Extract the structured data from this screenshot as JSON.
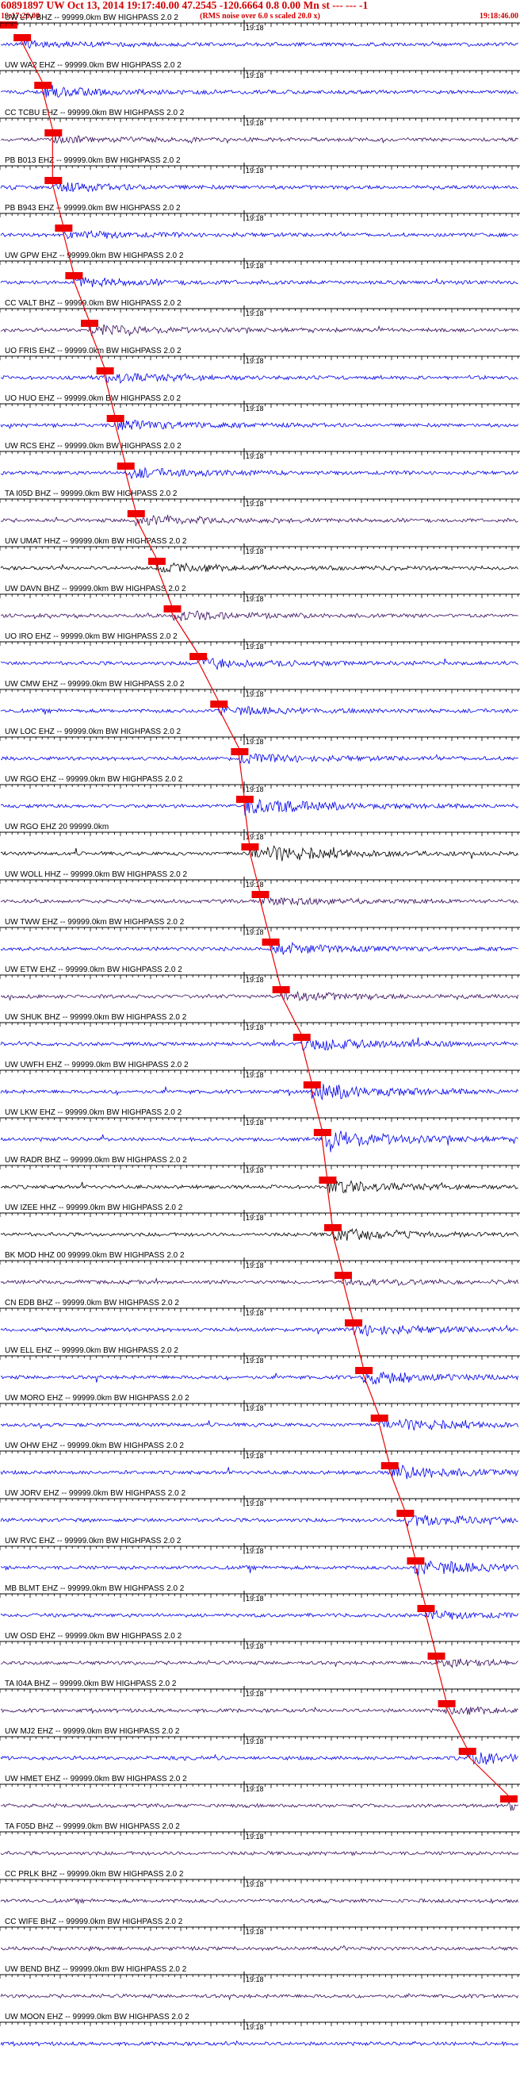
{
  "header": {
    "title": "60891897 UW Oct 13, 2014 19:17:40.00    47.2545 -120.6664  0.8 0.00 Mn st --- --- -1",
    "subtitle": "(RMS noise over 6.0 s scaled 20.0 x)",
    "start_time": "19:17:20.00",
    "end_time": "19:18:46.00"
  },
  "chart_data": {
    "type": "line",
    "time_axis": {
      "start": "19:17:20.00",
      "end": "19:18:46.00",
      "minute_mark": "19:18"
    },
    "trace_colors": {
      "blue": "#0000ee",
      "black": "#000000",
      "purple": "#3a1060",
      "pick": "#ee0000"
    },
    "traces": [
      {
        "label": "UW LTY BHZ -- 99999.0km BW  HIGHPASS  2.0  2",
        "color": "blue",
        "amp": 0.3,
        "pick": 0.04
      },
      {
        "label": "UW WA2 EHZ -- 99999.0km BW  HIGHPASS  2.0  2",
        "color": "blue",
        "amp": 0.55,
        "pick": 0.08
      },
      {
        "label": "CC TCBU EHZ -- 99999.0km BW  HIGHPASS  2.0  2",
        "color": "purple",
        "amp": 0.35,
        "pick": 0.1
      },
      {
        "label": "PB B013 EHZ -- 99999.0km BW  HIGHPASS  2.0  2",
        "color": "blue",
        "amp": 0.45,
        "pick": 0.1
      },
      {
        "label": "PB B943 EHZ -- 99999.0km BW  HIGHPASS  2.0  2",
        "color": "blue",
        "amp": 0.4,
        "pick": 0.12
      },
      {
        "label": "UW GPW EHZ -- 99999.0km BW  HIGHPASS  2.0  2",
        "color": "blue",
        "amp": 0.45,
        "pick": 0.14
      },
      {
        "label": "CC VALT BHZ -- 99999.0km BW  HIGHPASS  2.0  2",
        "color": "purple",
        "amp": 0.5,
        "pick": 0.17
      },
      {
        "label": "UO FRIS EHZ -- 99999.0km BW  HIGHPASS  2.0  2",
        "color": "blue",
        "amp": 0.5,
        "pick": 0.2
      },
      {
        "label": "UO HUO EHZ -- 99999.0km BW  HIGHPASS  2.0  2",
        "color": "blue",
        "amp": 0.55,
        "pick": 0.22
      },
      {
        "label": "UW RCS EHZ -- 99999.0km BW  HIGHPASS  2.0  2",
        "color": "blue",
        "amp": 0.5,
        "pick": 0.24
      },
      {
        "label": "TA I05D BHZ -- 99999.0km BW  HIGHPASS  2.0  2",
        "color": "purple",
        "amp": 0.6,
        "pick": 0.26
      },
      {
        "label": "UW UMAT HHZ -- 99999.0km BW  HIGHPASS  2.0  2",
        "color": "black",
        "amp": 0.5,
        "pick": 0.3
      },
      {
        "label": "UW DAVN BHZ -- 99999.0km BW  HIGHPASS  2.0  2",
        "color": "purple",
        "amp": 0.45,
        "pick": 0.33
      },
      {
        "label": "UO IRO EHZ -- 99999.0km BW  HIGHPASS  2.0  2",
        "color": "blue",
        "amp": 0.6,
        "pick": 0.38
      },
      {
        "label": "UW CMW EHZ -- 99999.0km BW  HIGHPASS  2.0  2",
        "color": "blue",
        "amp": 0.5,
        "pick": 0.42
      },
      {
        "label": "UW LOC EHZ -- 99999.0km BW  HIGHPASS  2.0  2",
        "color": "blue",
        "amp": 0.5,
        "pick": 0.46
      },
      {
        "label": "UW RGO EHZ -- 99999.0km BW  HIGHPASS  2.0  2",
        "color": "blue",
        "amp": 0.9,
        "pick": 0.47
      },
      {
        "label": "UW RGO EHZ 20 99999.0km",
        "color": "black",
        "amp": 1.0,
        "pick": 0.48
      },
      {
        "label": "UW WOLL HHZ -- 99999.0km BW  HIGHPASS  2.0  2",
        "color": "purple",
        "amp": 0.4,
        "pick": 0.5
      },
      {
        "label": "UW TWW EHZ -- 99999.0km BW  HIGHPASS  2.0  2",
        "color": "blue",
        "amp": 0.6,
        "pick": 0.52
      },
      {
        "label": "UW ETW EHZ -- 99999.0km BW  HIGHPASS  2.0  2",
        "color": "purple",
        "amp": 0.5,
        "pick": 0.54
      },
      {
        "label": "UW SHUK BHZ -- 99999.0km BW  HIGHPASS  2.0  2",
        "color": "blue",
        "amp": 0.8,
        "pick": 0.58
      },
      {
        "label": "UW UWFH EHZ -- 99999.0km BW  HIGHPASS  2.0  2",
        "color": "blue",
        "amp": 0.9,
        "pick": 0.6
      },
      {
        "label": "UW LKW EHZ -- 99999.0km BW  HIGHPASS  2.0  2",
        "color": "blue",
        "amp": 1.0,
        "pick": 0.62
      },
      {
        "label": "UW RADR BHZ -- 99999.0km BW  HIGHPASS  2.0  2",
        "color": "black",
        "amp": 0.6,
        "pick": 0.63
      },
      {
        "label": "UW IZEE HHZ -- 99999.0km BW  HIGHPASS  2.0  2",
        "color": "black",
        "amp": 0.6,
        "pick": 0.64
      },
      {
        "label": "BK MOD HHZ 00 99999.0km BW  HIGHPASS  2.0  2",
        "color": "purple",
        "amp": 0.35,
        "pick": 0.66
      },
      {
        "label": "CN EDB BHZ -- 99999.0km BW  HIGHPASS  2.0  2",
        "color": "blue",
        "amp": 0.6,
        "pick": 0.68
      },
      {
        "label": "UW ELL EHZ -- 99999.0km BW  HIGHPASS  2.0  2",
        "color": "blue",
        "amp": 0.7,
        "pick": 0.7
      },
      {
        "label": "UW MORO EHZ -- 99999.0km BW  HIGHPASS  2.0  2",
        "color": "blue",
        "amp": 0.7,
        "pick": 0.73
      },
      {
        "label": "UW OHW EHZ -- 99999.0km BW  HIGHPASS  2.0  2",
        "color": "blue",
        "amp": 0.7,
        "pick": 0.75
      },
      {
        "label": "UW JORV EHZ -- 99999.0km BW  HIGHPASS  2.0  2",
        "color": "blue",
        "amp": 0.6,
        "pick": 0.78
      },
      {
        "label": "UW RVC EHZ -- 99999.0km BW  HIGHPASS  2.0  2",
        "color": "blue",
        "amp": 0.9,
        "pick": 0.8
      },
      {
        "label": "MB BLMT EHZ -- 99999.0km BW  HIGHPASS  2.0  2",
        "color": "blue",
        "amp": 0.4,
        "pick": 0.82
      },
      {
        "label": "UW OSD EHZ -- 99999.0km BW  HIGHPASS  2.0  2",
        "color": "purple",
        "amp": 0.4,
        "pick": 0.84
      },
      {
        "label": "TA I04A BHZ -- 99999.0km BW  HIGHPASS  2.0  2",
        "color": "purple",
        "amp": 0.4,
        "pick": 0.86
      },
      {
        "label": "UW MJ2 EHZ -- 99999.0km BW  HIGHPASS  2.0  2",
        "color": "blue",
        "amp": 0.6,
        "pick": 0.9
      },
      {
        "label": "UW HMET EHZ -- 99999.0km BW  HIGHPASS  2.0  2",
        "color": "purple",
        "amp": 0.4,
        "pick": 0.98
      },
      {
        "label": "TA F05D BHZ -- 99999.0km BW  HIGHPASS  2.0  2",
        "color": "purple",
        "amp": 0.3,
        "pick": null
      },
      {
        "label": "CC PRLK BHZ -- 99999.0km BW  HIGHPASS  2.0  2",
        "color": "purple",
        "amp": 0.3,
        "pick": null
      },
      {
        "label": "CC WIFE BHZ -- 99999.0km BW  HIGHPASS  2.0  2",
        "color": "purple",
        "amp": 0.3,
        "pick": null
      },
      {
        "label": "UW BEND BHZ -- 99999.0km BW  HIGHPASS  2.0  2",
        "color": "purple",
        "amp": 0.3,
        "pick": null
      },
      {
        "label": "UW MOON EHZ -- 99999.0km BW  HIGHPASS  2.0  2",
        "color": "blue",
        "amp": 0.3,
        "pick": null
      }
    ]
  }
}
